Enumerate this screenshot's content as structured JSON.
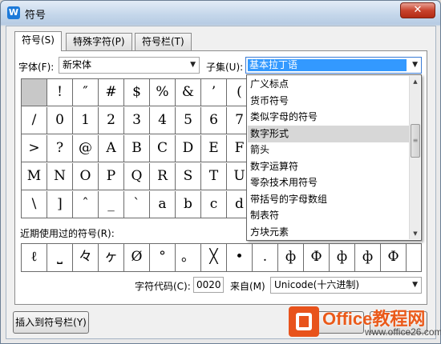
{
  "window": {
    "title": "符号",
    "close_label": "✕"
  },
  "tabs": [
    {
      "label": "符号(S)",
      "active": true
    },
    {
      "label": "特殊字符(P)",
      "active": false
    },
    {
      "label": "符号栏(T)",
      "active": false
    }
  ],
  "font": {
    "label": "字体(F):",
    "value": "新宋体"
  },
  "subset": {
    "label": "子集(U):",
    "value": "基本拉丁语"
  },
  "grid": [
    [
      "",
      "!",
      "″",
      "#",
      "$",
      "%",
      "&",
      "’",
      "(",
      "",
      "",
      "",
      "",
      "",
      "",
      ""
    ],
    [
      "/",
      "0",
      "1",
      "2",
      "3",
      "4",
      "5",
      "6",
      "7",
      "",
      "",
      "",
      "",
      "",
      "",
      ""
    ],
    [
      ">",
      "?",
      "@",
      "A",
      "B",
      "C",
      "D",
      "E",
      "F",
      "",
      "",
      "",
      "",
      "",
      "",
      ""
    ],
    [
      "M",
      "N",
      "O",
      "P",
      "Q",
      "R",
      "S",
      "T",
      "U",
      "",
      "",
      "",
      "",
      "",
      "",
      ""
    ],
    [
      "\\",
      "]",
      "ˆ",
      "_",
      "ˋ",
      "a",
      "b",
      "c",
      "d",
      "",
      "",
      "",
      "",
      "",
      "",
      ""
    ]
  ],
  "dropdown_items": [
    "广义标点",
    "货币符号",
    "类似字母的符号",
    "数字形式",
    "箭头",
    "数字运算符",
    "零杂技术用符号",
    "带括号的字母数组",
    "制表符",
    "方块元素"
  ],
  "dropdown_hover_index": 3,
  "recent": {
    "label": "近期使用过的符号(R):",
    "symbols": [
      "ℓ",
      "⎵",
      "々",
      "ヶ",
      "Ø",
      "°",
      "。",
      "╳",
      "•",
      ".",
      "ф",
      "Ф",
      "ф",
      "ф",
      "Ф"
    ]
  },
  "char_code": {
    "label": "字符代码(C):",
    "value": "0020"
  },
  "from": {
    "label": "来自(M)",
    "value": "Unicode(十六进制)"
  },
  "buttons": {
    "insert_to_bar": "插入到符号栏(Y)"
  },
  "watermark": {
    "brand": "Office教程网",
    "url": "www.office26.com"
  }
}
